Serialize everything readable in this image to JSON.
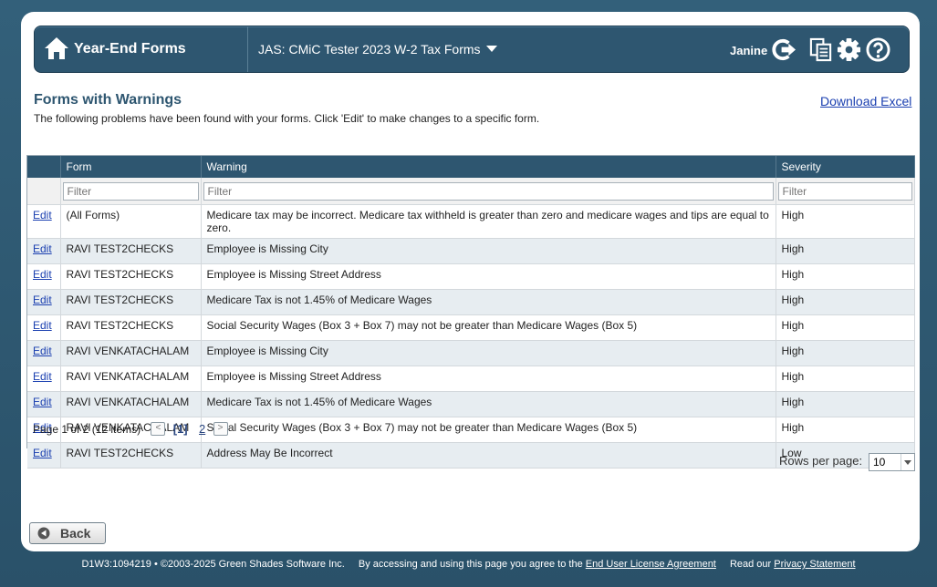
{
  "header": {
    "title": "Year-End Forms",
    "form_selector": "JAS: CMiC Tester 2023 W-2 Tax Forms",
    "user": "Janine"
  },
  "section": {
    "title": "Forms with Warnings",
    "description": "The following problems have been found with your forms. Click 'Edit' to make changes to a specific form.",
    "download_label": "Download Excel"
  },
  "grid": {
    "columns": [
      "",
      "Form",
      "Warning",
      "Severity"
    ],
    "filter_placeholder": "Filter",
    "edit_label": "Edit",
    "rows": [
      {
        "form": "(All Forms)",
        "warning": "Medicare tax may be incorrect. Medicare tax withheld is greater than zero and medicare wages and tips are equal to zero.",
        "severity": "High"
      },
      {
        "form": "RAVI TEST2CHECKS",
        "warning": "Employee is Missing City",
        "severity": "High"
      },
      {
        "form": "RAVI TEST2CHECKS",
        "warning": "Employee is Missing Street Address",
        "severity": "High"
      },
      {
        "form": "RAVI TEST2CHECKS",
        "warning": "Medicare Tax is not 1.45% of Medicare Wages",
        "severity": "High"
      },
      {
        "form": "RAVI TEST2CHECKS",
        "warning": "Social Security Wages (Box 3 + Box 7) may not be greater than Medicare Wages (Box 5)",
        "severity": "High"
      },
      {
        "form": "RAVI VENKATACHALAM",
        "warning": "Employee is Missing City",
        "severity": "High"
      },
      {
        "form": "RAVI VENKATACHALAM",
        "warning": "Employee is Missing Street Address",
        "severity": "High"
      },
      {
        "form": "RAVI VENKATACHALAM",
        "warning": "Medicare Tax is not 1.45% of Medicare Wages",
        "severity": "High"
      },
      {
        "form": "RAVI VENKATACHALAM",
        "warning": "Social Security Wages (Box 3 + Box 7) may not be greater than Medicare Wages (Box 5)",
        "severity": "High"
      },
      {
        "form": "RAVI TEST2CHECKS",
        "warning": "Address May Be Incorrect",
        "severity": "Low"
      }
    ]
  },
  "pager": {
    "info": "Page 1 of 2 (12 items)",
    "prev": "<",
    "current": "[1]",
    "page2": "2",
    "next": ">"
  },
  "rows_per_page": {
    "label": "Rows per page:",
    "value": "10"
  },
  "back_label": "Back",
  "footer": {
    "code": "D1W3:1094219 • ©2003-2025 Green Shades Software Inc.",
    "agree_text": "By accessing and using this page you agree to the",
    "eula": "End User License Agreement",
    "read_text": "Read our",
    "privacy": "Privacy Statement"
  },
  "icons": {
    "home": "home-icon",
    "logout": "logout-icon",
    "copy": "copy-icon",
    "settings": "gear-icon",
    "help": "help-icon",
    "back": "back-arrow-icon"
  },
  "colors": {
    "header_bg": "#2e5670",
    "link": "#1a3fb0",
    "alt_row": "#e7edf1"
  }
}
